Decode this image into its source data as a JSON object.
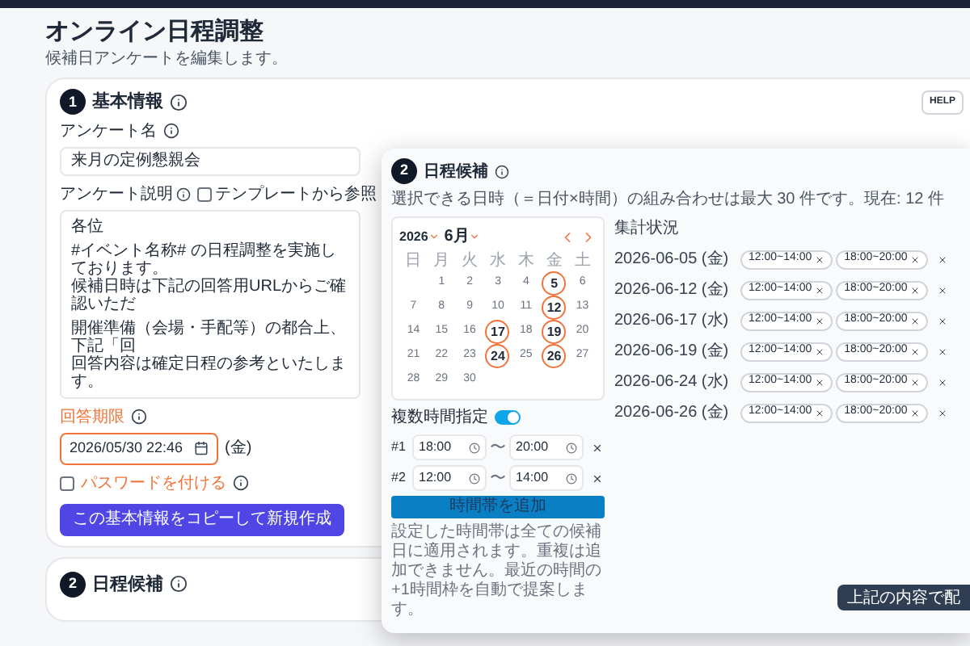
{
  "page": {
    "title": "オンライン日程調整",
    "subtitle": "候補日アンケートを編集します。"
  },
  "basic": {
    "step": "1",
    "title": "基本情報",
    "help": "HELP",
    "name": {
      "label": "アンケート名",
      "value": "来月の定例懇親会"
    },
    "description": {
      "label": "アンケート説明",
      "template": {
        "label": "テンプレートから参照",
        "checked": false
      },
      "paragraphs": [
        [
          "各位"
        ],
        [
          "#イベント名称# の日程調整を実施しております。",
          "候補日時は下記の回答用URLからご確認いただ"
        ],
        [
          "開催準備（会場・手配等）の都合上、下記「回",
          "回答内容は確定日程の参考といたします。"
        ]
      ]
    },
    "deadline": {
      "label": "回答期限",
      "value": "2026/05/30 22:46",
      "weekday": "(金)",
      "invalid": true
    },
    "password": {
      "label": "パスワードを付ける",
      "checked": false,
      "highlighted": true
    },
    "copy_button": "この基本情報をコピーして新規作成"
  },
  "candidates_section": {
    "step": "2",
    "title": "日程候補"
  },
  "popup": {
    "step": "2",
    "title": "日程候補",
    "info": "選択できる日時（＝日付×時間）の組み合わせは最大 30 件です。現在: 12 件",
    "calendar": {
      "year": "2026",
      "month": "6月",
      "weekdays": [
        "日",
        "月",
        "火",
        "水",
        "木",
        "金",
        "土"
      ],
      "weeks": [
        {
          "right_aligned": true,
          "days": [
            {
              "day": "1",
              "selected": false
            },
            {
              "day": "2",
              "selected": false
            },
            {
              "day": "3",
              "selected": false
            },
            {
              "day": "4",
              "selected": false
            },
            {
              "day": "5",
              "selected": true
            },
            {
              "day": "6",
              "selected": false
            }
          ]
        },
        {
          "right_aligned": false,
          "days": [
            {
              "day": "7",
              "selected": false
            },
            {
              "day": "8",
              "selected": false
            },
            {
              "day": "9",
              "selected": false
            },
            {
              "day": "10",
              "selected": false
            },
            {
              "day": "11",
              "selected": false
            },
            {
              "day": "12",
              "selected": true
            },
            {
              "day": "13",
              "selected": false
            }
          ]
        },
        {
          "right_aligned": false,
          "days": [
            {
              "day": "14",
              "selected": false
            },
            {
              "day": "15",
              "selected": false
            },
            {
              "day": "16",
              "selected": false
            },
            {
              "day": "17",
              "selected": true
            },
            {
              "day": "18",
              "selected": false
            },
            {
              "day": "19",
              "selected": true
            },
            {
              "day": "20",
              "selected": false
            }
          ]
        },
        {
          "right_aligned": false,
          "days": [
            {
              "day": "21",
              "selected": false
            },
            {
              "day": "22",
              "selected": false
            },
            {
              "day": "23",
              "selected": false
            },
            {
              "day": "24",
              "selected": true
            },
            {
              "day": "25",
              "selected": false
            },
            {
              "day": "26",
              "selected": true
            },
            {
              "day": "27",
              "selected": false
            }
          ]
        },
        {
          "right_aligned": false,
          "days": [
            {
              "day": "28",
              "selected": false
            },
            {
              "day": "29",
              "selected": false
            },
            {
              "day": "30",
              "selected": false
            }
          ]
        }
      ]
    },
    "multi_time": {
      "label": "複数時間指定",
      "on": true
    },
    "time_rows": [
      {
        "index": "#1",
        "start": "18:00",
        "separator": "〜",
        "end": "20:00"
      },
      {
        "index": "#2",
        "start": "12:00",
        "separator": "〜",
        "end": "14:00"
      }
    ],
    "add_button": "時間帯を追加",
    "note": "設定した時間帯は全ての候補日に適用されます。重複は追加できません。最近の時間の+1時間枠を自動で提案します。",
    "summary": {
      "title": "集計状況",
      "rows": [
        {
          "date": "2026-06-05 (金)",
          "slots": [
            "12:00~14:00",
            "18:00~20:00"
          ]
        },
        {
          "date": "2026-06-12 (金)",
          "slots": [
            "12:00~14:00",
            "18:00~20:00"
          ]
        },
        {
          "date": "2026-06-17 (水)",
          "slots": [
            "12:00~14:00",
            "18:00~20:00"
          ]
        },
        {
          "date": "2026-06-19 (金)",
          "slots": [
            "12:00~14:00",
            "18:00~20:00"
          ]
        },
        {
          "date": "2026-06-24 (水)",
          "slots": [
            "12:00~14:00",
            "18:00~20:00"
          ]
        },
        {
          "date": "2026-06-26 (金)",
          "slots": [
            "12:00~14:00",
            "18:00~20:00"
          ]
        }
      ]
    },
    "distribute_button": "上記の内容で配"
  }
}
